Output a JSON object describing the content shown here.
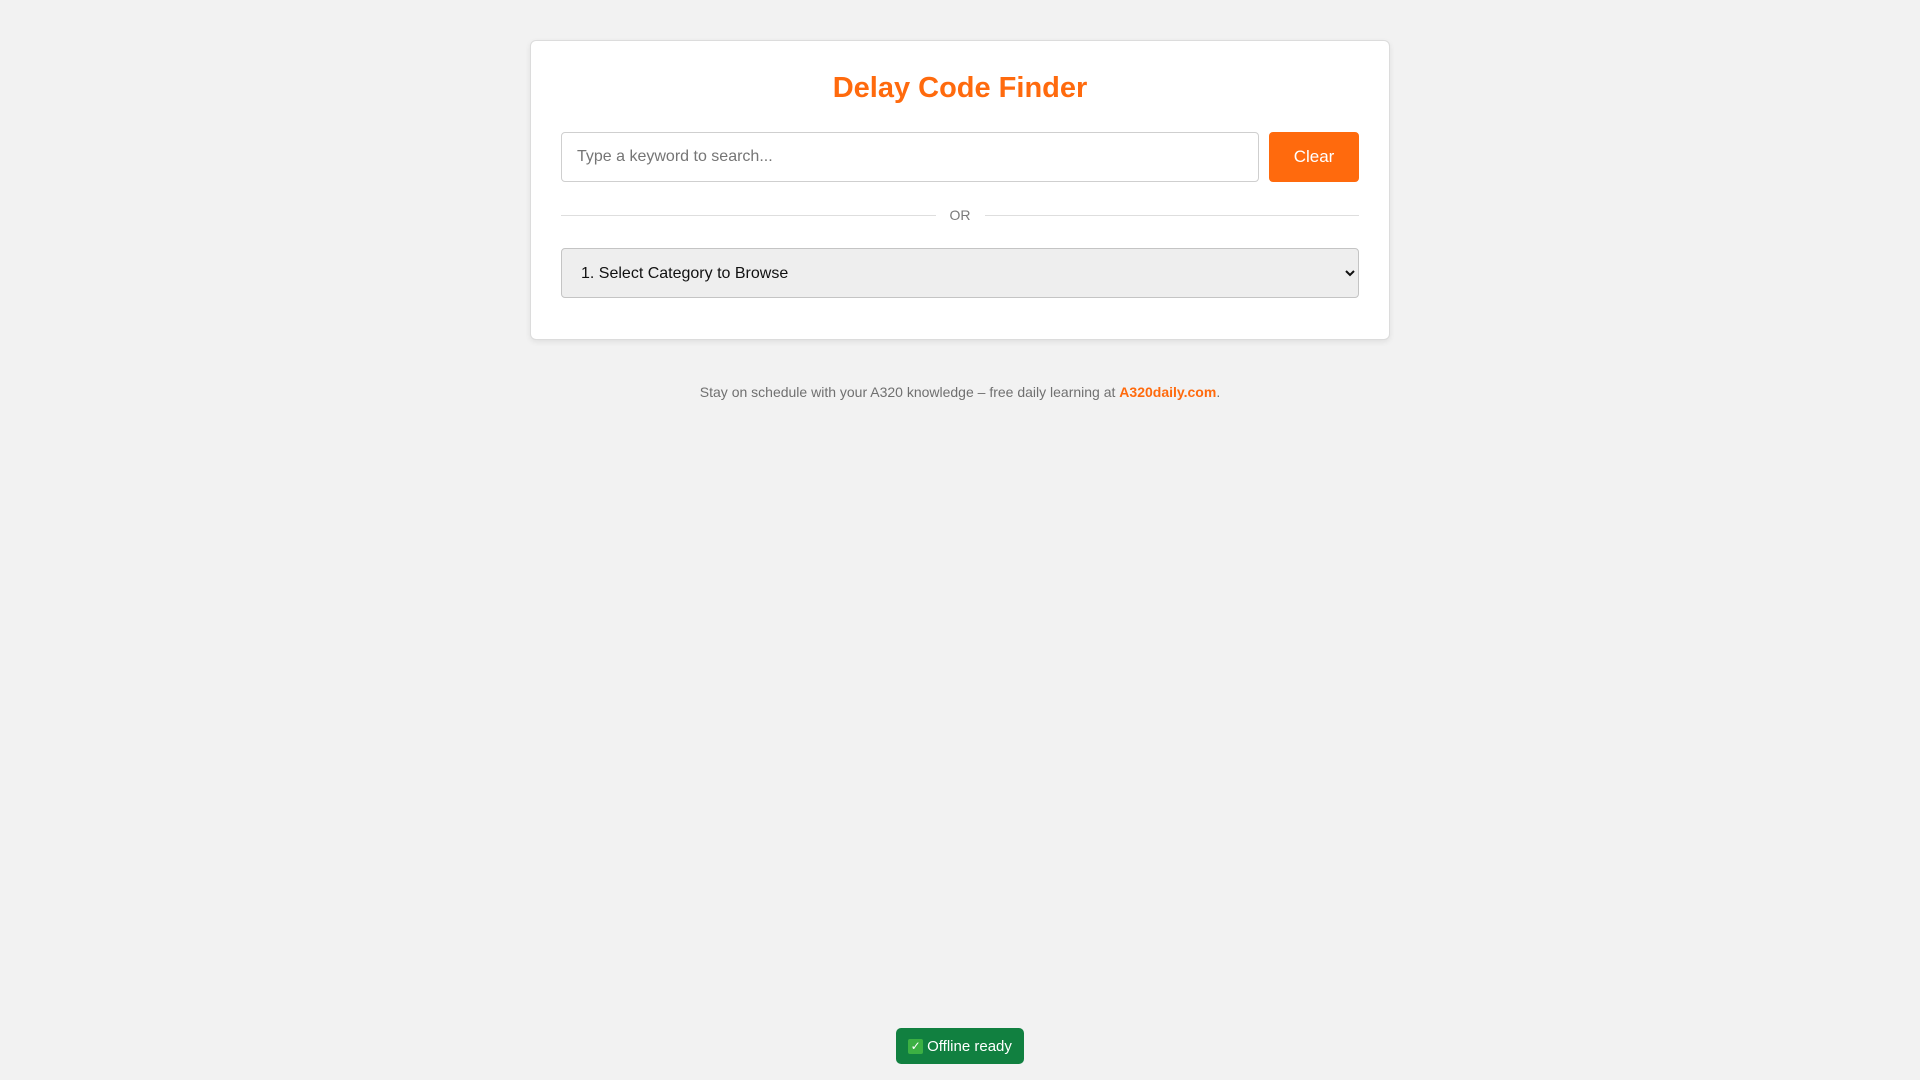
{
  "header": {
    "title": "Delay Code Finder"
  },
  "search": {
    "placeholder": "Type a keyword to search...",
    "value": "",
    "clear_label": "Clear"
  },
  "divider": {
    "label": "OR"
  },
  "category": {
    "selected": "1. Select Category to Browse"
  },
  "footer": {
    "prefix": "Stay on schedule with your A320 knowledge – free daily learning at ",
    "link_text": "A320daily.com",
    "suffix": "."
  },
  "status": {
    "icon": "check-icon",
    "label": "Offline ready"
  },
  "colors": {
    "accent": "#ff6a0d",
    "background": "#f2f2f2",
    "badge": "#118040"
  }
}
